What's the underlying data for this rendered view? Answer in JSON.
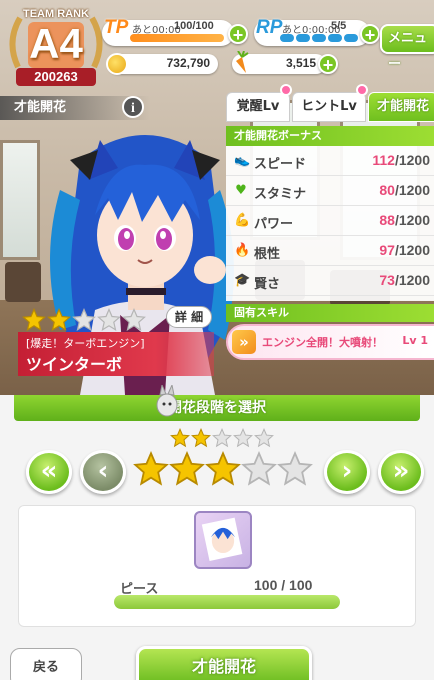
{
  "header": {
    "team_rank_label": "TEAM RANK",
    "team_rank": "A4",
    "team_score": "200263",
    "tp": {
      "label": "TP",
      "timer": "あと00:00",
      "value": "100/100",
      "fraction": 1.0
    },
    "rp": {
      "label": "RP",
      "timer": "あと0:00:00",
      "value": "5/5",
      "pips": 5
    },
    "menu_label": "メニュー",
    "money": "732,790",
    "carrots": "3,515"
  },
  "section": {
    "title": "才能開花",
    "info_label": "i"
  },
  "tabs": [
    {
      "label": "覚醒Lv",
      "active": false
    },
    {
      "label": "ヒントLv",
      "active": false
    },
    {
      "label": "才能開花",
      "active": true
    }
  ],
  "bonus": {
    "title": "才能開花ボーナス",
    "stats": [
      {
        "icon": "speed-icon",
        "glyph": "👟",
        "name": "スピード",
        "current": "112",
        "max": "/1200"
      },
      {
        "icon": "heart-icon",
        "glyph": "♥",
        "name": "スタミナ",
        "current": "80",
        "max": "/1200"
      },
      {
        "icon": "power-icon",
        "glyph": "💪",
        "name": "パワー",
        "current": "88",
        "max": "/1200"
      },
      {
        "icon": "flame-icon",
        "glyph": "🔥",
        "name": "根性",
        "current": "97",
        "max": "/1200"
      },
      {
        "icon": "cap-icon",
        "glyph": "🎓",
        "name": "賢さ",
        "current": "73",
        "max": "/1200"
      }
    ]
  },
  "skill": {
    "title": "固有スキル",
    "name": "エンジン全開！大噴射！",
    "level": "Lv 1"
  },
  "character": {
    "rarity_filled": 2,
    "rarity_total": 5,
    "detail_label": "詳 細",
    "title": "[爆走！ターボエンジン]",
    "name": "ツインターボ"
  },
  "bloom": {
    "header": "開花段階を選択",
    "current_stars_filled": 2,
    "target_stars_filled": 3,
    "stars_total": 5,
    "piece_label": "ピース",
    "piece_count": "100 / 100",
    "piece_fraction": 1.0,
    "back_label": "戻る",
    "confirm_label": "才能開花"
  },
  "colors": {
    "accent_green": "#6fbf1f",
    "stat_pink": "#e84a79",
    "tp_orange": "#ff8e1d",
    "rp_blue": "#2a9adb",
    "star_gold": "#f5c400"
  }
}
